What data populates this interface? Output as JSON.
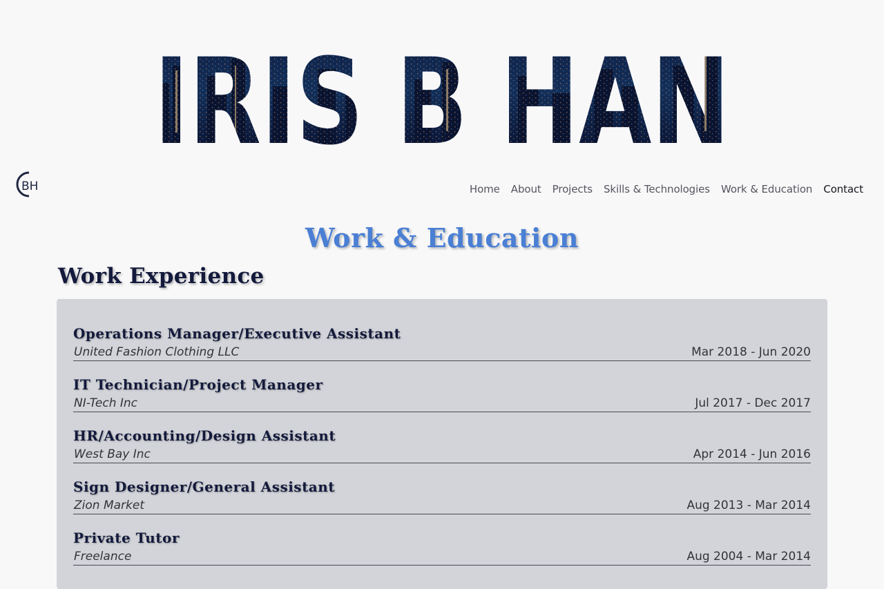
{
  "hero": {
    "name": "IRIS B HAN"
  },
  "logo": {
    "text": "BH"
  },
  "nav": {
    "items": [
      {
        "label": "Home"
      },
      {
        "label": "About"
      },
      {
        "label": "Projects"
      },
      {
        "label": "Skills & Technologies"
      },
      {
        "label": "Work & Education"
      },
      {
        "label": "Contact"
      }
    ]
  },
  "page": {
    "title": "Work & Education"
  },
  "work": {
    "heading": "Work Experience",
    "entries": [
      {
        "role": "Operations Manager/Executive Assistant",
        "org": "United Fashion Clothing LLC",
        "dates": "Mar 2018 - Jun 2020"
      },
      {
        "role": "IT Technician/Project Manager",
        "org": "NI-Tech Inc",
        "dates": "Jul 2017 - Dec 2017"
      },
      {
        "role": "HR/Accounting/Design Assistant",
        "org": "West Bay Inc",
        "dates": "Apr 2014 - Jun 2016"
      },
      {
        "role": "Sign Designer/General Assistant",
        "org": "Zion Market",
        "dates": "Aug 2013 - Mar 2014"
      },
      {
        "role": "Private Tutor",
        "org": "Freelance",
        "dates": "Aug 2004 - Mar 2014"
      }
    ]
  },
  "colors": {
    "accent": "#4a7fd4",
    "navy": "#131a3b",
    "card": "#d2d4d9",
    "background": "#f8f8f9"
  }
}
